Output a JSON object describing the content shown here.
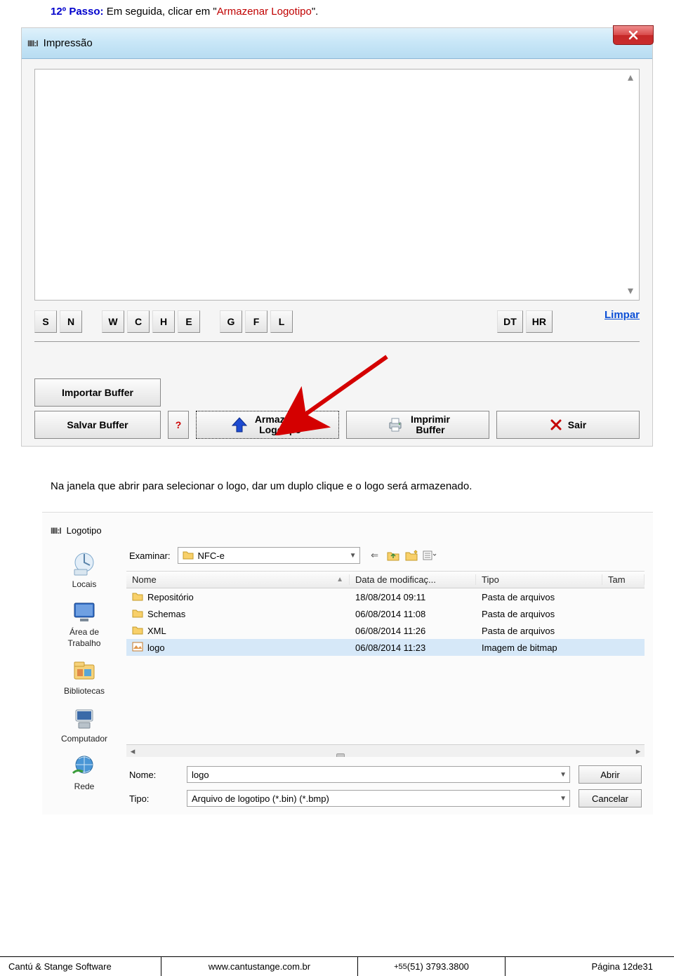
{
  "instruction": {
    "step_label": "12º Passo:",
    "before": " Em seguida, clicar em \"",
    "quoted": "Armazenar Logotipo",
    "after": "\"."
  },
  "shot1": {
    "title": "Impressão",
    "letter_buttons": [
      "S",
      "N",
      "W",
      "C",
      "H",
      "E",
      "G",
      "F",
      "L",
      "DT",
      "HR"
    ],
    "link_limpar": "Limpar",
    "btn_importar": "Importar Buffer",
    "btn_salvar": "Salvar Buffer",
    "btn_q": "?",
    "btn_armazenar_l1": "Armazenar",
    "btn_armazenar_l2": "Logotipo",
    "btn_imprimir_l1": "Imprimir",
    "btn_imprimir_l2": "Buffer",
    "btn_sair": "Sair"
  },
  "middle_text": "Na janela que abrir para selecionar o logo, dar um duplo clique e o logo será armazenado.",
  "shot2": {
    "title": "Logotipo",
    "examinar_label": "Examinar:",
    "examinar_value": "NFC-e",
    "places": {
      "p1": "Locais",
      "p2a": "Área de",
      "p2b": "Trabalho",
      "p3": "Bibliotecas",
      "p4": "Computador",
      "p5": "Rede"
    },
    "columns": {
      "c1": "Nome",
      "c2": "Data de modificaç...",
      "c3": "Tipo",
      "c4": "Tam"
    },
    "rows": [
      {
        "name": "Repositório",
        "date": "18/08/2014 09:11",
        "type": "Pasta de arquivos",
        "kind": "folder"
      },
      {
        "name": "Schemas",
        "date": "06/08/2014 11:08",
        "type": "Pasta de arquivos",
        "kind": "folder"
      },
      {
        "name": "XML",
        "date": "06/08/2014 11:26",
        "type": "Pasta de arquivos",
        "kind": "folder"
      },
      {
        "name": "logo",
        "date": "06/08/2014 11:23",
        "type": "Imagem de bitmap",
        "kind": "file"
      }
    ],
    "nome_label": "Nome:",
    "nome_value": "logo",
    "tipo_label": "Tipo:",
    "tipo_value": "Arquivo de logotipo (*.bin) (*.bmp)",
    "btn_abrir": "Abrir",
    "btn_cancelar": "Cancelar"
  },
  "footer": {
    "company": "Cantú & Stange Software",
    "url": "www.cantustange.com.br",
    "phone_prefix": "+55 ",
    "phone": "(51) 3793.3800",
    "page_label": "Página",
    "page_current": "12",
    "page_sep": " de ",
    "page_total": "31"
  }
}
